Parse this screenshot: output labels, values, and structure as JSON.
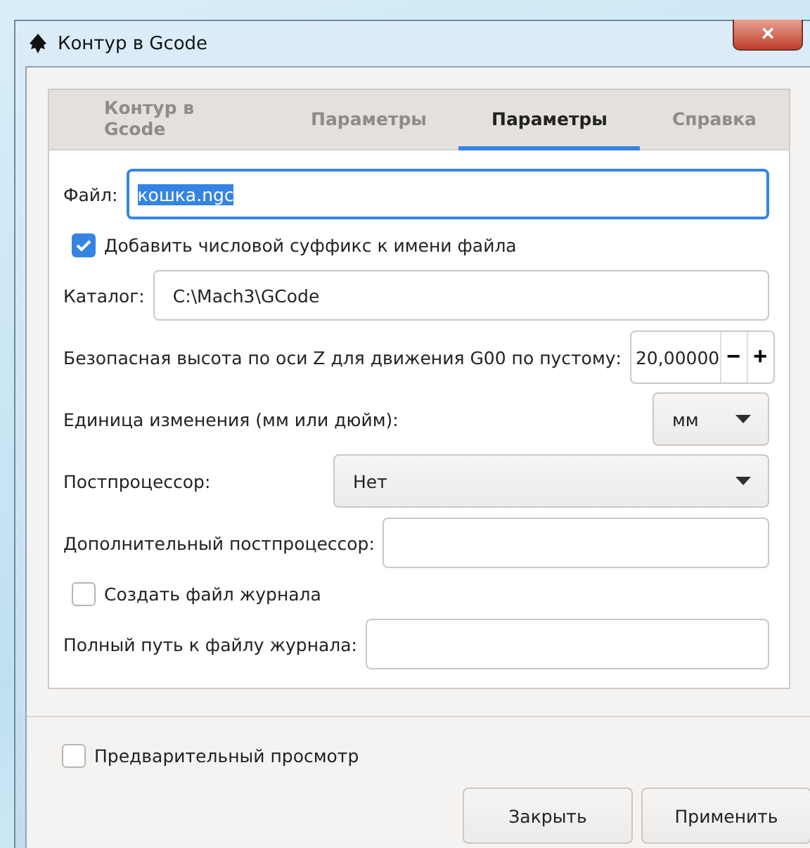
{
  "window": {
    "title": "Контур в Gcode",
    "close": "×"
  },
  "tabs": [
    {
      "label": "Контур в Gcode",
      "selected": false
    },
    {
      "label": "Параметры",
      "selected": false
    },
    {
      "label": "Параметры",
      "selected": true
    },
    {
      "label": "Справка",
      "selected": false
    }
  ],
  "fields": [
    {
      "kind": "text",
      "label": "Файл:",
      "value": "кошка.ngc",
      "focused": true
    },
    {
      "kind": "checkbox",
      "label": "Добавить числовой суффикс к имени файла",
      "checked": true
    },
    {
      "kind": "text",
      "label": "Каталог:",
      "value": "C:\\Mach3\\GCode",
      "focused": false
    },
    {
      "kind": "spin",
      "label": "Безопасная высота по оси Z для движения G00 по пустому:",
      "value": "20,00000",
      "minus": "−",
      "plus": "+"
    },
    {
      "kind": "unit-dropdown",
      "label": "Единица изменения (мм или дюйм):",
      "value": "мм"
    },
    {
      "kind": "dropdown",
      "label": "Постпроцессор:",
      "value": "Нет"
    },
    {
      "kind": "text",
      "label": "Дополнительный постпроцессор:",
      "focused": false
    },
    {
      "kind": "checkbox",
      "label": "Создать файл журнала",
      "checked": false
    },
    {
      "kind": "text",
      "label": "Полный путь к файлу журнала:",
      "focused": false
    }
  ],
  "preview": {
    "label": "Предварительный просмотр",
    "checked": false
  },
  "buttons": [
    "Закрыть",
    "Применить"
  ]
}
